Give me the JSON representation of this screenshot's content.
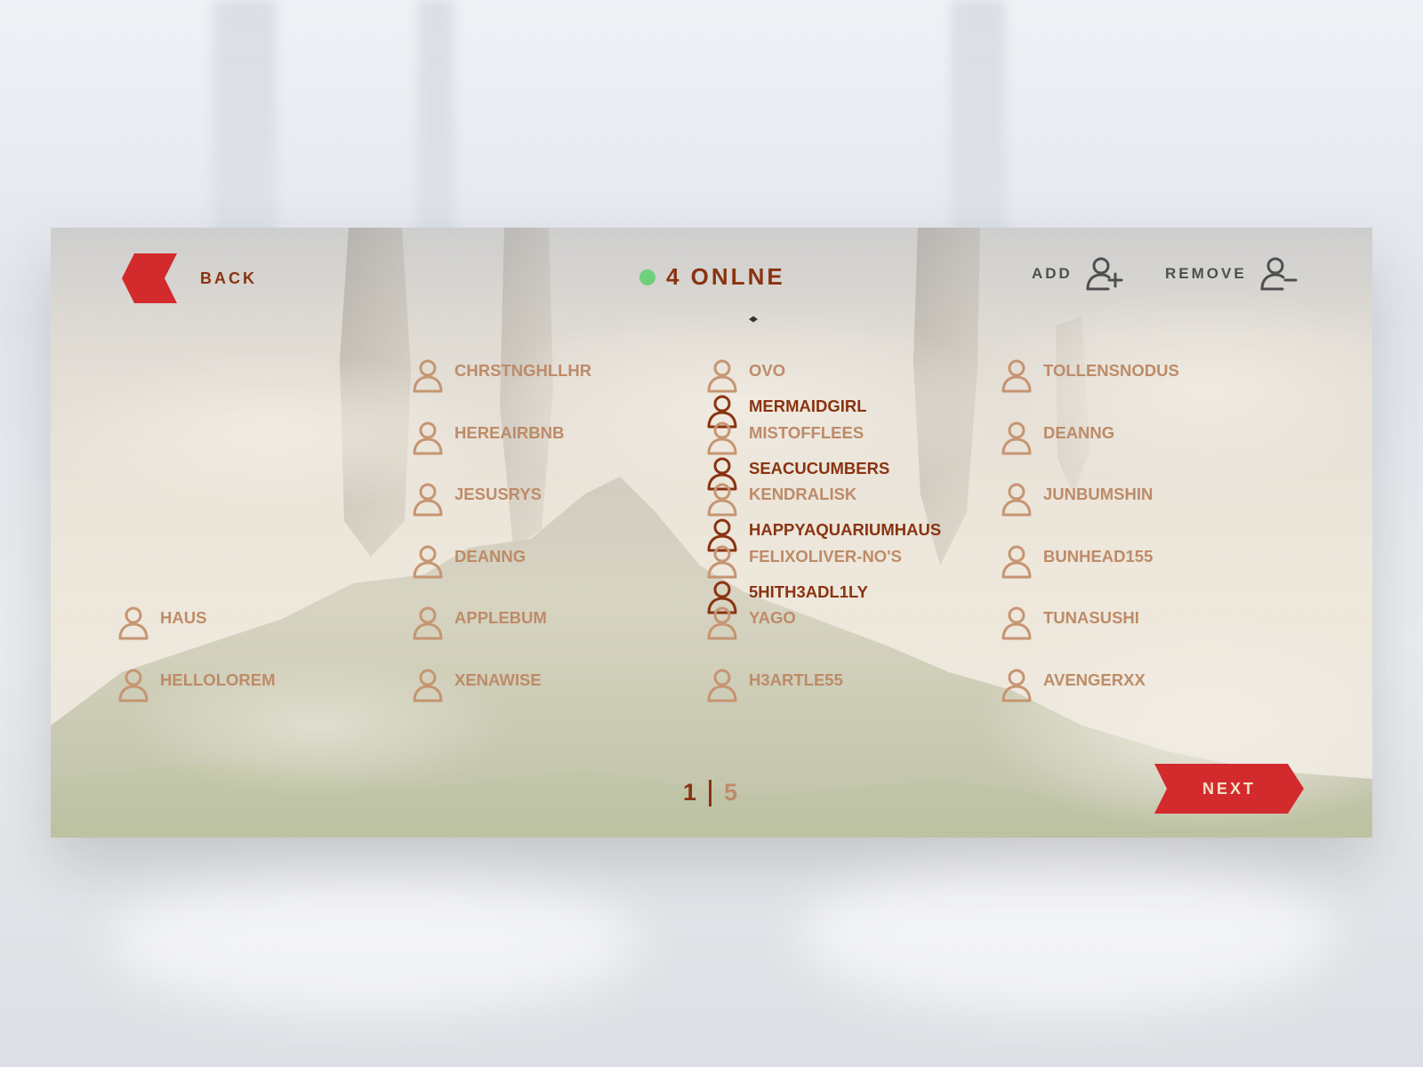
{
  "header": {
    "back_label": "BACK",
    "online_label": "4 ONLNE",
    "add_label": "ADD",
    "remove_label": "REMOVE"
  },
  "users": [
    [
      {
        "name": "MERMAIDGIRL",
        "online": true
      },
      {
        "name": "SEACUCUMBERS",
        "online": true
      },
      {
        "name": "HAPPYAQUARIUMHAUS",
        "online": true
      },
      {
        "name": "5HITH3ADL1LY",
        "online": true
      },
      {
        "name": "HAUS",
        "online": false
      },
      {
        "name": "HELLOLOREM",
        "online": false
      }
    ],
    [
      {
        "name": "CHRSTNGHLLHR",
        "online": false
      },
      {
        "name": "HEREAIRBNB",
        "online": false
      },
      {
        "name": "JESUSRYS",
        "online": false
      },
      {
        "name": "DEANNG",
        "online": false
      },
      {
        "name": "APPLEBUM",
        "online": false
      },
      {
        "name": "XENAWISE",
        "online": false
      }
    ],
    [
      {
        "name": "OVO",
        "online": false
      },
      {
        "name": "MISTOFFLEES",
        "online": false
      },
      {
        "name": "KENDRALISK",
        "online": false
      },
      {
        "name": "FELIXOLIVER-NO'S",
        "online": false
      },
      {
        "name": "YAGO",
        "online": false
      },
      {
        "name": "H3ARTLE55",
        "online": false
      }
    ],
    [
      {
        "name": "TOLLENSNODUS",
        "online": false
      },
      {
        "name": "DEANNG",
        "online": false
      },
      {
        "name": "JUNBUMSHIN",
        "online": false
      },
      {
        "name": "BUNHEAD155",
        "online": false
      },
      {
        "name": "TUNASUSHI",
        "online": false
      },
      {
        "name": "AVENGERXX",
        "online": false
      }
    ]
  ],
  "pagination": {
    "current": "1",
    "total": "5"
  },
  "next_label": "NEXT",
  "colors": {
    "accent_red": "#d32a2e",
    "online_text": "#8a3311",
    "offline_text": "#bd8b68",
    "online_dot": "#6fd07b"
  },
  "icons": {
    "back": "back-arrow-icon",
    "online": "online-status-dot",
    "add": "user-plus-icon",
    "remove": "user-minus-icon",
    "user": "user-icon",
    "next": "next-arrow-icon"
  }
}
